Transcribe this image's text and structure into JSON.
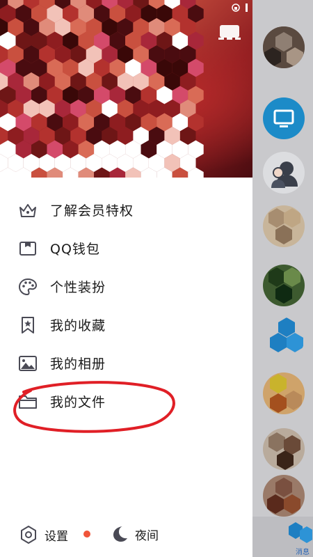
{
  "menu": {
    "items": [
      {
        "label": "了解会员特权",
        "icon": "crown-icon"
      },
      {
        "label": "QQ钱包",
        "icon": "wallet-icon"
      },
      {
        "label": "个性装扮",
        "icon": "palette-icon"
      },
      {
        "label": "我的收藏",
        "icon": "bookmark-star-icon"
      },
      {
        "label": "我的相册",
        "icon": "image-icon"
      },
      {
        "label": "我的文件",
        "icon": "folder-icon"
      }
    ]
  },
  "bottom": {
    "settings_label": "设置",
    "night_label": "夜间"
  },
  "right_strip": {
    "tab_label": "消息"
  },
  "colors": {
    "annotation_red": "#e01f26",
    "badge": "#f0553a",
    "tv_blue": "#1c8bc8",
    "icon_gray": "#4a4a55"
  }
}
